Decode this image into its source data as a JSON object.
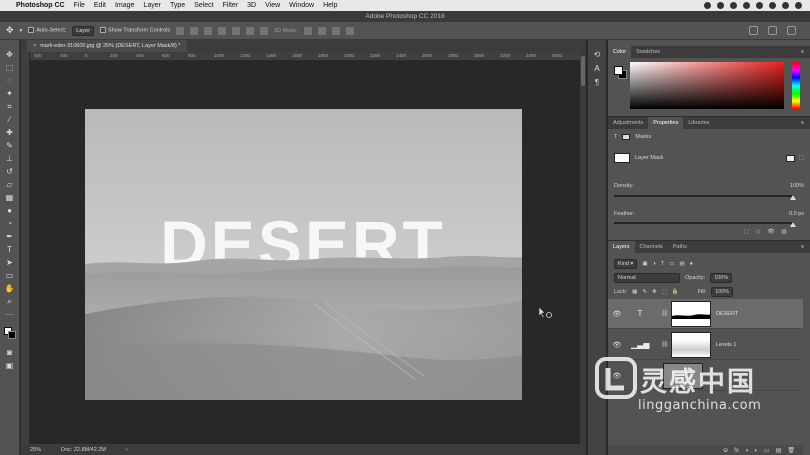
{
  "menubar": {
    "app": "Photoshop CC",
    "items": [
      "File",
      "Edit",
      "Image",
      "Layer",
      "Type",
      "Select",
      "Filter",
      "3D",
      "View",
      "Window",
      "Help"
    ]
  },
  "titlebar": {
    "title": "Adobe Photoshop CC 2018"
  },
  "options": {
    "auto_select": "Auto-Select:",
    "auto_select_value": "Layer",
    "transform": "Show Transform Controls",
    "mode_3d": "3D Mode:"
  },
  "document": {
    "tab": "mark-eder-310600.jpg @ 25% (DESERT, Layer Mask/8) *",
    "close": "×",
    "image_text": "DESERT",
    "ruler_labels": [
      "400",
      "200",
      "0",
      "200",
      "400",
      "600",
      "800",
      "1000",
      "1200",
      "1400",
      "1600",
      "1800",
      "2000",
      "2200",
      "2400",
      "2600",
      "2800",
      "3000",
      "3200",
      "3400",
      "3600"
    ]
  },
  "status": {
    "zoom": "25%",
    "doc": "Doc: 22.8M/42.2M",
    "arrow": "›"
  },
  "panels": {
    "color_tabs": [
      "Color",
      "Swatches"
    ],
    "props_tabs": [
      "Adjustments",
      "Properties",
      "Libraries"
    ],
    "masks_label": "Masks",
    "layer_mask_label": "Layer Mask",
    "density_label": "Density:",
    "density_value": "100%",
    "feather_label": "Feather:",
    "feather_value": "0.0 px",
    "layers_tabs": [
      "Layers",
      "Channels",
      "Paths"
    ],
    "filter_kind": "Kind",
    "blend_mode": "Normal",
    "opacity_label": "Opacity:",
    "opacity_value": "100%",
    "lock_label": "Lock:",
    "fill_label": "Fill:",
    "fill_value": "100%",
    "layers": [
      {
        "name": "DESERT",
        "icon": "type-icon",
        "selected": true
      },
      {
        "name": "Levels 1",
        "icon": "levels-icon",
        "selected": false
      },
      {
        "name": "",
        "icon": "",
        "selected": false
      }
    ],
    "bottom_tools": [
      "⊖",
      "fx",
      "◑",
      "◐",
      "▭",
      "▤",
      "🗑"
    ]
  },
  "watermark": {
    "cn": "灵感中国",
    "en": "lingganchina.com"
  },
  "colors": {
    "accent_red": "#e8201c",
    "panel": "#535353",
    "canvas_bg": "#282828"
  }
}
